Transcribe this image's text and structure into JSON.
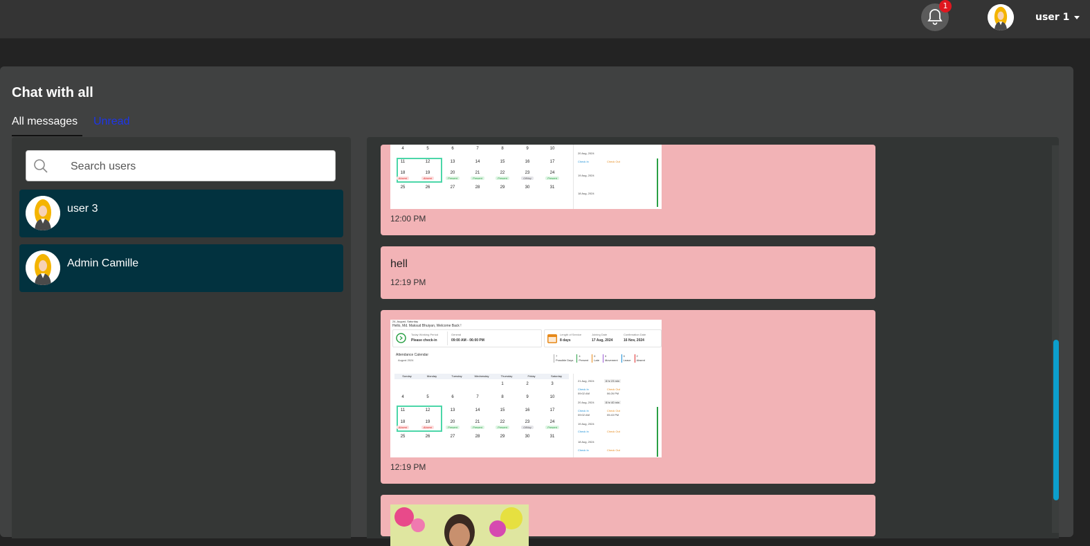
{
  "header": {
    "notification_count": "1",
    "user_name": "user 1"
  },
  "page": {
    "title": "Chat with all",
    "tabs": [
      {
        "label": "All messages",
        "active": true
      },
      {
        "label": "Unread",
        "active": false
      }
    ]
  },
  "search": {
    "placeholder": "Search users"
  },
  "users": [
    {
      "name": "user 3"
    },
    {
      "name": "Admin Camille"
    }
  ],
  "messages": [
    {
      "type": "image",
      "time": "12:00 PM"
    },
    {
      "type": "text",
      "text": "hell",
      "time": "12:19 PM"
    },
    {
      "type": "image",
      "time": "12:19 PM"
    },
    {
      "type": "image",
      "time": ""
    }
  ],
  "screenshot": {
    "date_line": "24, August, Saturday",
    "greeting": "Hello, Md. Maksud Bhuiyan, Welcome Back !",
    "working_period_label": "Today Working Period",
    "working_period_value": "Please check-in",
    "general_label": "General",
    "general_value": "09:00 AM - 06:00 PM",
    "service_label": "Length of Service",
    "service_value": "8 days",
    "joining_label": "Joining Date",
    "joining_value": "17 Aug, 2024",
    "confirm_label": "Confirmation Date",
    "confirm_value": "16 Nov, 2024",
    "calendar_title": "Attendance Calendar",
    "month": "August 2024",
    "stats": [
      {
        "value": "7",
        "label": "Possible Days"
      },
      {
        "value": "4",
        "label": "Present"
      },
      {
        "value": "0",
        "label": "Late"
      },
      {
        "value": "0",
        "label": "Movement"
      },
      {
        "value": "0",
        "label": "Leave"
      },
      {
        "value": "2",
        "label": "Absent"
      }
    ],
    "weekdays": [
      "Sunday",
      "Monday",
      "Tuesday",
      "Wednesday",
      "Thursday",
      "Friday",
      "Saturday"
    ],
    "weeks": [
      [
        "",
        "",
        "",
        "",
        "1",
        "2",
        "3"
      ],
      [
        "4",
        "5",
        "6",
        "7",
        "8",
        "9",
        "10"
      ],
      [
        "11",
        "12",
        "13",
        "14",
        "15",
        "16",
        "17"
      ],
      [
        "18",
        "19",
        "20",
        "21",
        "22",
        "23",
        "24"
      ],
      [
        "25",
        "26",
        "27",
        "28",
        "29",
        "30",
        "31"
      ]
    ],
    "week4_status": [
      "Absent",
      "Absent",
      "Present",
      "Present",
      "Present",
      "Offday",
      "Present"
    ],
    "entries": [
      {
        "date": "21 Aug, 2024",
        "duration": "8 hr 23 min",
        "in": "09:02 AM",
        "out": "06:26 PM"
      },
      {
        "date": "20 Aug, 2024",
        "duration": "8 hr 40 min",
        "in": "09:02 AM",
        "out": "05:43 PM"
      },
      {
        "date": "19 Aug, 2024",
        "duration": "",
        "in": "",
        "out": ""
      },
      {
        "date": "18 Aug, 2024",
        "duration": "",
        "in": "",
        "out": ""
      }
    ],
    "check_in_label": "Check In",
    "check_out_label": "Check Out"
  }
}
